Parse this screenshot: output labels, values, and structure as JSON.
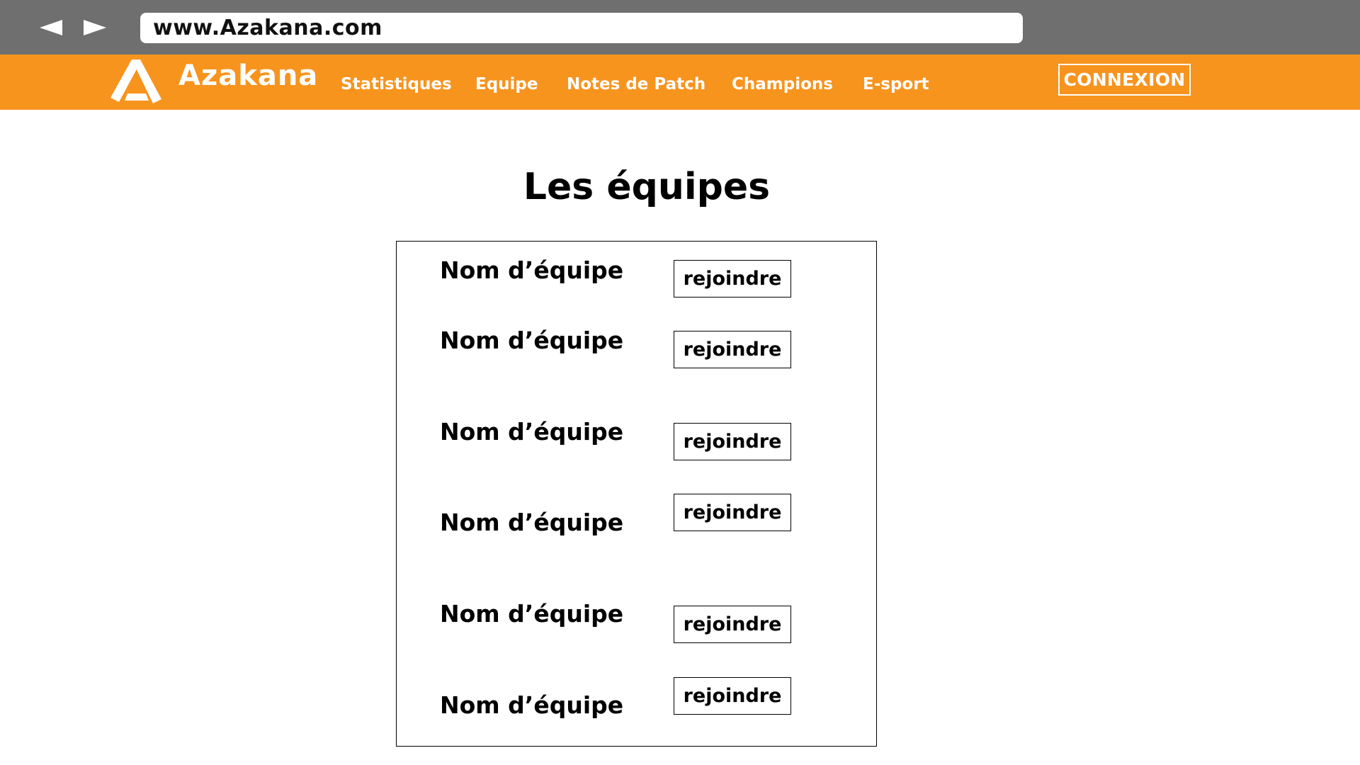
{
  "browser": {
    "url": "www.Azakana.com",
    "back_icon": "back-arrow-icon",
    "forward_icon": "forward-arrow-icon"
  },
  "header": {
    "brand": "Azakana",
    "logo_icon": "azakana-a-logo",
    "nav": [
      "Statistiques",
      "Equipe",
      "Notes de Patch",
      "Champions",
      "E-sport"
    ],
    "login_label": "CONNEXION"
  },
  "main": {
    "title": "Les équipes",
    "teams": [
      {
        "name": "Nom d’équipe",
        "join_label": "rejoindre"
      },
      {
        "name": "Nom d’équipe",
        "join_label": "rejoindre"
      },
      {
        "name": "Nom d’équipe",
        "join_label": "rejoindre"
      },
      {
        "name": "Nom d’équipe",
        "join_label": "rejoindre"
      },
      {
        "name": "Nom d’équipe",
        "join_label": "rejoindre"
      },
      {
        "name": "Nom d’équipe",
        "join_label": "rejoindre"
      }
    ]
  },
  "colors": {
    "browser_bar": "#6f6f6f",
    "header_accent": "#f7941e",
    "text": "#000000"
  }
}
